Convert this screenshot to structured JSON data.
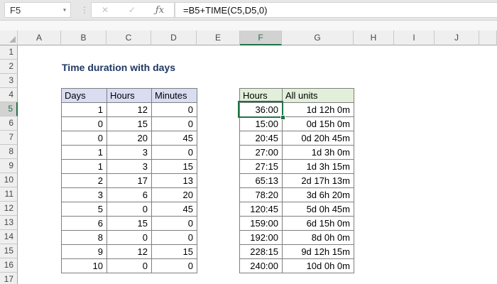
{
  "formula_bar": {
    "name_box": "F5",
    "dropdown_arrow": "▾",
    "splitter": "⋮",
    "cancel_label": "✕",
    "enter_label": "✓",
    "fx_label": "ƒx",
    "formula": "=B5+TIME(C5,D5,0)"
  },
  "sheet": {
    "column_headers": [
      "A",
      "B",
      "C",
      "D",
      "E",
      "F",
      "G",
      "H",
      "I",
      "J"
    ],
    "row_headers": [
      "1",
      "2",
      "3",
      "4",
      "5",
      "6",
      "7",
      "8",
      "9",
      "10",
      "11",
      "12",
      "13",
      "14",
      "15",
      "16",
      "17"
    ],
    "selected_column": "F",
    "selected_row": "5",
    "active_cell": "F5",
    "title": "Time duration with days",
    "left_table": {
      "headers": [
        "Days",
        "Hours",
        "Minutes"
      ],
      "rows": [
        [
          "1",
          "12",
          "0"
        ],
        [
          "0",
          "15",
          "0"
        ],
        [
          "0",
          "20",
          "45"
        ],
        [
          "1",
          "3",
          "0"
        ],
        [
          "1",
          "3",
          "15"
        ],
        [
          "2",
          "17",
          "13"
        ],
        [
          "3",
          "6",
          "20"
        ],
        [
          "5",
          "0",
          "45"
        ],
        [
          "6",
          "15",
          "0"
        ],
        [
          "8",
          "0",
          "0"
        ],
        [
          "9",
          "12",
          "15"
        ],
        [
          "10",
          "0",
          "0"
        ]
      ]
    },
    "right_table": {
      "headers": [
        "Hours",
        "All units"
      ],
      "rows": [
        [
          "36:00",
          "1d 12h 0m"
        ],
        [
          "15:00",
          "0d 15h 0m"
        ],
        [
          "20:45",
          "0d 20h 45m"
        ],
        [
          "27:00",
          "1d 3h 0m"
        ],
        [
          "27:15",
          "1d 3h 15m"
        ],
        [
          "65:13",
          "2d 17h 13m"
        ],
        [
          "78:20",
          "3d 6h 20m"
        ],
        [
          "120:45",
          "5d 0h 45m"
        ],
        [
          "159:00",
          "6d 15h 0m"
        ],
        [
          "192:00",
          "8d 0h 0m"
        ],
        [
          "228:15",
          "9d 12h 15m"
        ],
        [
          "240:00",
          "10d 0h 0m"
        ]
      ]
    }
  },
  "colors": {
    "accent_green": "#217346",
    "left_header_fill": "#d9ddf2",
    "right_header_fill": "#e2efda",
    "title_color": "#1f3864"
  }
}
